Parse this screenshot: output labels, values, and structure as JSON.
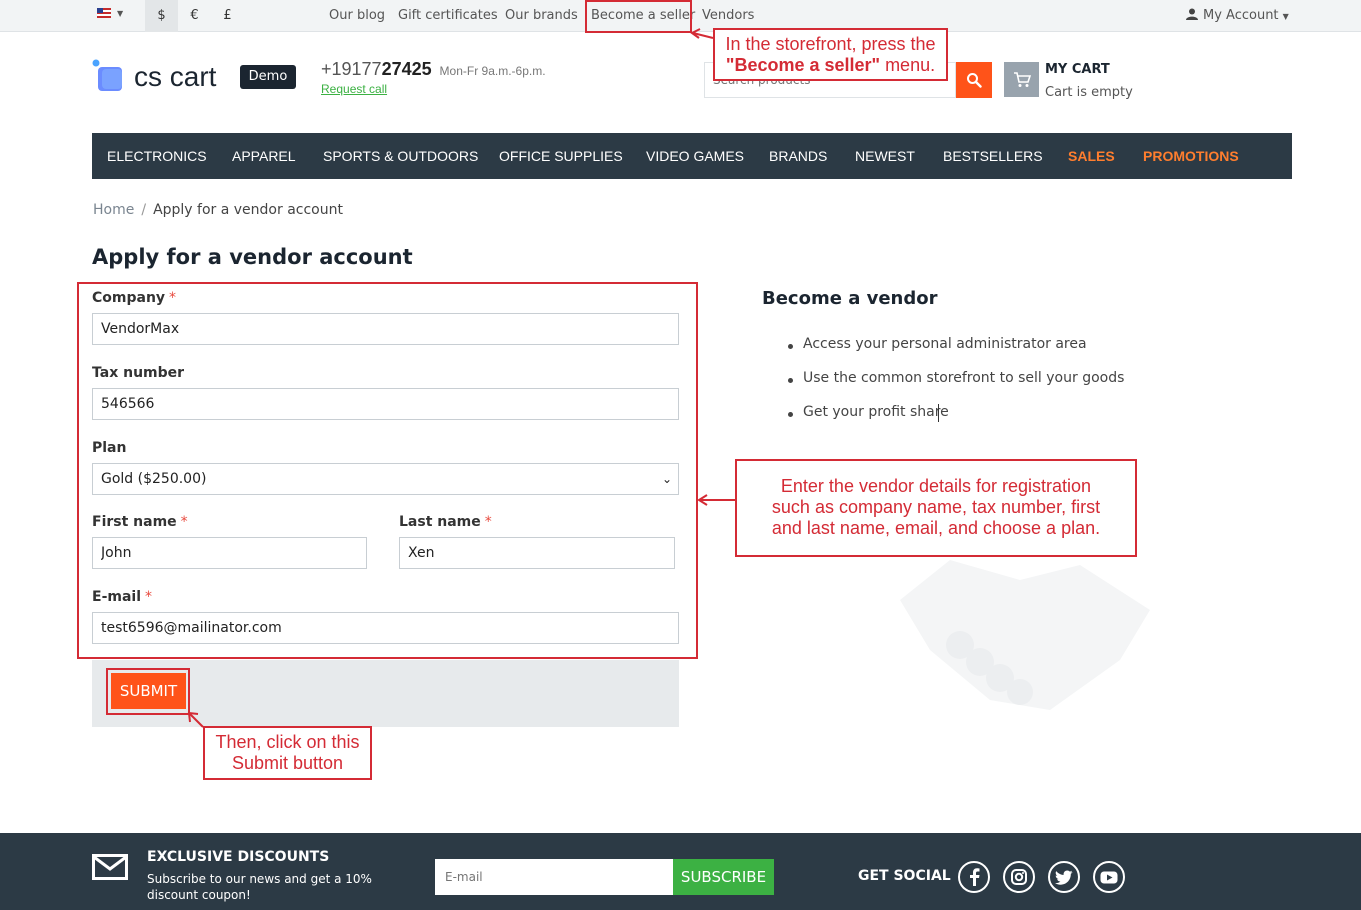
{
  "topbar": {
    "currencies": [
      "$",
      "€",
      "£"
    ],
    "links": [
      "Our blog",
      "Gift certificates",
      "Our brands",
      "Become a seller",
      "Vendors"
    ],
    "account_label": "My Account"
  },
  "header": {
    "logo_text": "cs cart",
    "demo_badge": "Demo",
    "phone_prefix": "+19177",
    "phone_main": "27425",
    "hours": "Mon-Fr 9a.m.-6p.m.",
    "request_call": "Request call",
    "search_placeholder": "Search products",
    "cart_title": "MY CART",
    "cart_status": "Cart is empty"
  },
  "nav": {
    "items": [
      "ELECTRONICS",
      "APPAREL",
      "SPORTS & OUTDOORS",
      "OFFICE SUPPLIES",
      "VIDEO GAMES",
      "BRANDS",
      "NEWEST",
      "BESTSELLERS",
      "SALES",
      "PROMOTIONS"
    ]
  },
  "breadcrumb": {
    "home": "Home",
    "separator": "/",
    "current": "Apply for a vendor account"
  },
  "page_title": "Apply for a vendor account",
  "form": {
    "company": {
      "label": "Company",
      "value": "VendorMax",
      "required": "*"
    },
    "tax_number": {
      "label": "Tax number",
      "value": "546566"
    },
    "plan": {
      "label": "Plan",
      "value": "Gold ($250.00)"
    },
    "first_name": {
      "label": "First name",
      "value": "John",
      "required": "*"
    },
    "last_name": {
      "label": "Last name",
      "value": "Xen",
      "required": "*"
    },
    "email": {
      "label": "E-mail",
      "value": "test6596@mailinator.com",
      "required": "*"
    },
    "submit_label": "SUBMIT"
  },
  "vendor_info": {
    "title": "Become a vendor",
    "benefits": [
      "Access your personal administrator area",
      "Use the common storefront to sell your goods",
      "Get your profit share"
    ]
  },
  "annotations": {
    "seller_menu": {
      "line1": "In the storefront, press the",
      "bold": "\"Become a seller\"",
      "rest": " menu."
    },
    "details": {
      "line1": "Enter the vendor details for registration",
      "line2": "such as company name, tax number, first",
      "line3": "and last name, email, and choose a plan."
    },
    "submit": {
      "line1": "Then, click on this",
      "line2": "Submit button"
    }
  },
  "footer": {
    "discount_title": "EXCLUSIVE DISCOUNTS",
    "discount_sub": "Subscribe to our news and get a 10% discount coupon!",
    "email_placeholder": "E-mail",
    "subscribe_label": "SUBSCRIBE",
    "social_title": "GET SOCIAL",
    "social_icons": [
      "facebook-icon",
      "instagram-icon",
      "twitter-icon",
      "youtube-icon"
    ]
  },
  "colors": {
    "accent": "#ff5319",
    "nav_bg": "#2c3a45",
    "promo": "#ff7e2e",
    "green": "#3cb143",
    "annotation_red": "#d42b35"
  }
}
